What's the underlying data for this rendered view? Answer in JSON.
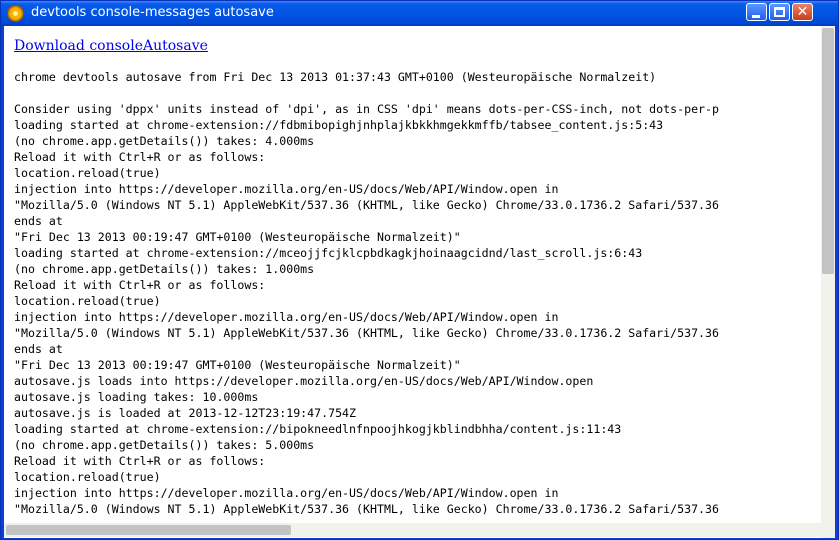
{
  "window": {
    "title": "devtools console-messages autosave",
    "icon": "app-icon",
    "accent": "#0055e5",
    "controls": [
      "minimize",
      "maximize",
      "close"
    ],
    "close_glyph": "✕"
  },
  "content": {
    "download_link": "Download consoleAutosave",
    "log_lines": [
      "chrome devtools autosave from Fri Dec 13 2013 01:37:43 GMT+0100 (Westeuropäische Normalzeit)",
      "",
      "Consider using 'dppx' units instead of 'dpi', as in CSS 'dpi' means dots-per-CSS-inch, not dots-per-p",
      "loading started at chrome-extension://fdbmibopighjnhplajkbkkhmgekkmffb/tabsee_content.js:5:43",
      "(no chrome.app.getDetails()) takes: 4.000ms",
      "Reload it with Ctrl+R or as follows:",
      "location.reload(true)",
      "injection into https://developer.mozilla.org/en-US/docs/Web/API/Window.open in",
      "\"Mozilla/5.0 (Windows NT 5.1) AppleWebKit/537.36 (KHTML, like Gecko) Chrome/33.0.1736.2 Safari/537.36",
      "ends at",
      "\"Fri Dec 13 2013 00:19:47 GMT+0100 (Westeuropäische Normalzeit)\"",
      "loading started at chrome-extension://mceojjfcjklcpbdkagkjhoinaagcidnd/last_scroll.js:6:43",
      "(no chrome.app.getDetails()) takes: 1.000ms",
      "Reload it with Ctrl+R or as follows:",
      "location.reload(true)",
      "injection into https://developer.mozilla.org/en-US/docs/Web/API/Window.open in",
      "\"Mozilla/5.0 (Windows NT 5.1) AppleWebKit/537.36 (KHTML, like Gecko) Chrome/33.0.1736.2 Safari/537.36",
      "ends at",
      "\"Fri Dec 13 2013 00:19:47 GMT+0100 (Westeuropäische Normalzeit)\"",
      "autosave.js loads into https://developer.mozilla.org/en-US/docs/Web/API/Window.open",
      "autosave.js loading takes: 10.000ms",
      "autosave.js is loaded at 2013-12-12T23:19:47.754Z",
      "loading started at chrome-extension://bipokneedlnfnpoojhkogjkblindbhha/content.js:11:43",
      "(no chrome.app.getDetails()) takes: 5.000ms",
      "Reload it with Ctrl+R or as follows:",
      "location.reload(true)",
      "injection into https://developer.mozilla.org/en-US/docs/Web/API/Window.open in",
      "\"Mozilla/5.0 (Windows NT 5.1) AppleWebKit/537.36 (KHTML, like Gecko) Chrome/33.0.1736.2 Safari/537.36"
    ]
  }
}
